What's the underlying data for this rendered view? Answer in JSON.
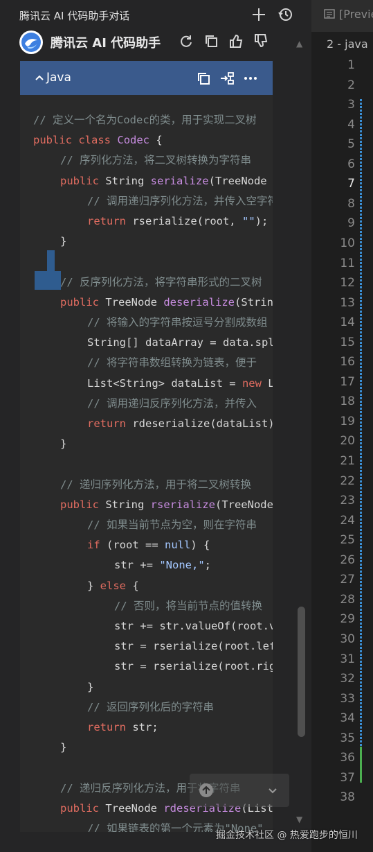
{
  "topbar": {
    "title": "腾讯云 AI 代码助手对话"
  },
  "assistant": {
    "name": "腾讯云 AI 代码助手"
  },
  "code_block": {
    "language": "Java",
    "lines": [
      {
        "indent": 0,
        "tokens": [
          {
            "t": "comment",
            "v": "// 定义一个名为Codec的类，用于实现二叉树"
          }
        ]
      },
      {
        "indent": 0,
        "tokens": [
          {
            "t": "kw",
            "v": "public"
          },
          {
            "t": "plain",
            "v": " "
          },
          {
            "t": "kw",
            "v": "class"
          },
          {
            "t": "plain",
            "v": " "
          },
          {
            "t": "fn",
            "v": "Codec"
          },
          {
            "t": "plain",
            "v": " {"
          }
        ]
      },
      {
        "indent": 1,
        "tokens": [
          {
            "t": "comment",
            "v": "// 序列化方法，将二叉树转换为字符串"
          }
        ]
      },
      {
        "indent": 1,
        "tokens": [
          {
            "t": "kw",
            "v": "public"
          },
          {
            "t": "plain",
            "v": " String "
          },
          {
            "t": "fn",
            "v": "serialize"
          },
          {
            "t": "plain",
            "v": "(TreeNode root) {"
          }
        ]
      },
      {
        "indent": 2,
        "tokens": [
          {
            "t": "comment",
            "v": "// 调用递归序列化方法，并传入空字符串"
          }
        ]
      },
      {
        "indent": 2,
        "tokens": [
          {
            "t": "kw",
            "v": "return"
          },
          {
            "t": "plain",
            "v": " rserialize(root, "
          },
          {
            "t": "str",
            "v": "\"\""
          },
          {
            "t": "plain",
            "v": ");"
          }
        ]
      },
      {
        "indent": 1,
        "tokens": [
          {
            "t": "plain",
            "v": "}"
          }
        ]
      },
      {
        "indent": 0,
        "tokens": []
      },
      {
        "indent": 1,
        "tokens": [
          {
            "t": "comment",
            "v": "// 反序列化方法，将字符串形式的二叉树"
          }
        ]
      },
      {
        "indent": 1,
        "tokens": [
          {
            "t": "kw",
            "v": "public"
          },
          {
            "t": "plain",
            "v": " TreeNode "
          },
          {
            "t": "fn",
            "v": "deserialize"
          },
          {
            "t": "plain",
            "v": "(String data) {"
          }
        ]
      },
      {
        "indent": 2,
        "tokens": [
          {
            "t": "comment",
            "v": "// 将输入的字符串按逗号分割成数组"
          }
        ]
      },
      {
        "indent": 2,
        "tokens": [
          {
            "t": "plain",
            "v": "String[] dataArray = data.split"
          }
        ]
      },
      {
        "indent": 2,
        "tokens": [
          {
            "t": "comment",
            "v": "// 将字符串数组转换为链表，便于"
          }
        ]
      },
      {
        "indent": 2,
        "tokens": [
          {
            "t": "plain",
            "v": "List<String> dataList = "
          },
          {
            "t": "kw",
            "v": "new"
          },
          {
            "t": "plain",
            "v": " LinkedList"
          }
        ]
      },
      {
        "indent": 2,
        "tokens": [
          {
            "t": "comment",
            "v": "// 调用递归反序列化方法，并传入"
          }
        ]
      },
      {
        "indent": 2,
        "tokens": [
          {
            "t": "kw",
            "v": "return"
          },
          {
            "t": "plain",
            "v": " rdeserialize(dataList);"
          }
        ]
      },
      {
        "indent": 1,
        "tokens": [
          {
            "t": "plain",
            "v": "}"
          }
        ]
      },
      {
        "indent": 0,
        "tokens": []
      },
      {
        "indent": 1,
        "tokens": [
          {
            "t": "comment",
            "v": "// 递归序列化方法，用于将二叉树转换"
          }
        ]
      },
      {
        "indent": 1,
        "tokens": [
          {
            "t": "kw",
            "v": "public"
          },
          {
            "t": "plain",
            "v": " String "
          },
          {
            "t": "fn",
            "v": "rserialize"
          },
          {
            "t": "plain",
            "v": "(TreeNode root"
          }
        ]
      },
      {
        "indent": 2,
        "tokens": [
          {
            "t": "comment",
            "v": "// 如果当前节点为空，则在字符串"
          }
        ]
      },
      {
        "indent": 2,
        "tokens": [
          {
            "t": "kw",
            "v": "if"
          },
          {
            "t": "plain",
            "v": " (root == "
          },
          {
            "t": "str",
            "v": "null"
          },
          {
            "t": "plain",
            "v": ") {"
          }
        ]
      },
      {
        "indent": 3,
        "tokens": [
          {
            "t": "plain",
            "v": "str += "
          },
          {
            "t": "str",
            "v": "\"None,\""
          },
          {
            "t": "plain",
            "v": ";"
          }
        ]
      },
      {
        "indent": 2,
        "tokens": [
          {
            "t": "plain",
            "v": "} "
          },
          {
            "t": "kw",
            "v": "else"
          },
          {
            "t": "plain",
            "v": " {"
          }
        ]
      },
      {
        "indent": 3,
        "tokens": [
          {
            "t": "comment",
            "v": "// 否则，将当前节点的值转换"
          }
        ]
      },
      {
        "indent": 3,
        "tokens": [
          {
            "t": "plain",
            "v": "str += str.valueOf(root.val"
          }
        ]
      },
      {
        "indent": 3,
        "tokens": [
          {
            "t": "plain",
            "v": "str = rserialize(root.left"
          }
        ]
      },
      {
        "indent": 3,
        "tokens": [
          {
            "t": "plain",
            "v": "str = rserialize(root.right"
          }
        ]
      },
      {
        "indent": 2,
        "tokens": [
          {
            "t": "plain",
            "v": "}"
          }
        ]
      },
      {
        "indent": 2,
        "tokens": [
          {
            "t": "comment",
            "v": "// 返回序列化后的字符串"
          }
        ]
      },
      {
        "indent": 2,
        "tokens": [
          {
            "t": "kw",
            "v": "return"
          },
          {
            "t": "plain",
            "v": " str;"
          }
        ]
      },
      {
        "indent": 1,
        "tokens": [
          {
            "t": "plain",
            "v": "}"
          }
        ]
      },
      {
        "indent": 0,
        "tokens": []
      },
      {
        "indent": 1,
        "tokens": [
          {
            "t": "comment",
            "v": "// 递归反序列化方法，用于将字符串"
          }
        ]
      },
      {
        "indent": 1,
        "tokens": [
          {
            "t": "kw",
            "v": "public"
          },
          {
            "t": "plain",
            "v": " TreeNode "
          },
          {
            "t": "fn",
            "v": "rdeserialize"
          },
          {
            "t": "plain",
            "v": "(List"
          }
        ]
      },
      {
        "indent": 2,
        "tokens": [
          {
            "t": "comment",
            "v": "// 如果链表的第一个元素为\"None\""
          }
        ]
      }
    ]
  },
  "editor": {
    "preview_tab": "[Preview]",
    "file_tab": "2 - java",
    "active_line": 7,
    "line_numbers": [
      "1",
      "2",
      "3",
      "4",
      "5",
      "6",
      "7",
      "8",
      "9",
      "10",
      "11",
      "12",
      "13",
      "14",
      "15",
      "16",
      "17",
      "18",
      "19",
      "20",
      "21",
      "22",
      "23",
      "24",
      "25",
      "26",
      "27",
      "28",
      "29",
      "30",
      "31",
      "32",
      "33",
      "34",
      "35",
      "36",
      "37",
      "38"
    ]
  },
  "watermark": "掘金技术社区 @ 热爱跑步的恒川",
  "colors": {
    "code_header": "#3a5a8c",
    "gutter_modified": "#3a8fd6",
    "gutter_added": "#4caf50"
  }
}
